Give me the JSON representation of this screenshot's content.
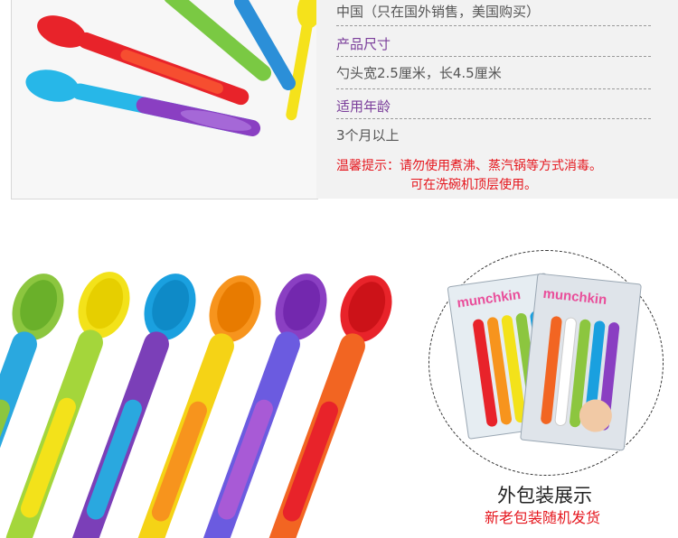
{
  "spec": {
    "origin_value": "中国（只在国外销售，美国购买）",
    "size_label": "产品尺寸",
    "size_value": "勺头宽2.5厘米，长4.5厘米",
    "age_label": "适用年龄",
    "age_value": "3个月以上",
    "warning_line1": "温馨提示：请勿使用煮沸、蒸汽锅等方式消毒。",
    "warning_line2": "可在洗碗机顶层使用。"
  },
  "packaging": {
    "brand": "munchkin",
    "caption": "外包装展示",
    "note": "新老包装随机发货"
  },
  "colors": {
    "label_purple": "#7a3d9a",
    "warning_red": "#e5161d"
  }
}
